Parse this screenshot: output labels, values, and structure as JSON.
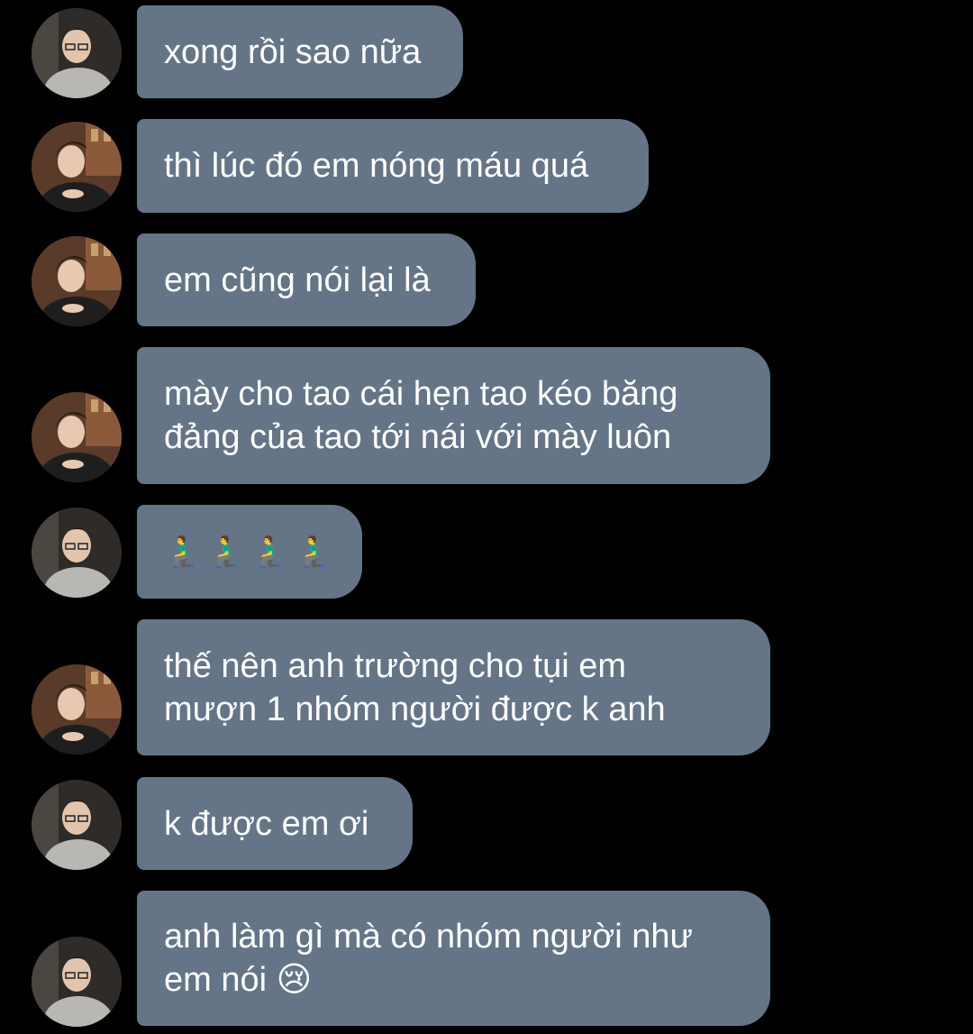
{
  "palette": {
    "background": "#000000",
    "bubble": "#657587",
    "text": "#ffffff"
  },
  "messages": [
    {
      "sender": "user-a",
      "avatar": "avatar-glasses-icon",
      "lines": [
        "xong rồi sao nữa"
      ]
    },
    {
      "sender": "user-b",
      "avatar": "avatar-suit-icon",
      "lines": [
        "thì lúc đó em nóng máu quá"
      ]
    },
    {
      "sender": "user-b",
      "avatar": "avatar-suit-icon",
      "lines": [
        "em cũng nói lại là"
      ]
    },
    {
      "sender": "user-b",
      "avatar": "avatar-suit-icon",
      "lines": [
        "mày cho tao cái hẹn tao kéo băng",
        "đảng của tao tới nái với mày luôn"
      ]
    },
    {
      "sender": "user-a",
      "avatar": "avatar-glasses-icon",
      "lines": [
        "🧎‍♂️🧎‍♂️🧎‍♂️🧎‍♂️"
      ]
    },
    {
      "sender": "user-b",
      "avatar": "avatar-suit-icon",
      "lines": [
        "thế nên anh trường cho tụi em",
        "mượn 1 nhóm người được k anh"
      ]
    },
    {
      "sender": "user-a",
      "avatar": "avatar-glasses-icon",
      "lines": [
        "k được em ơi"
      ]
    },
    {
      "sender": "user-a",
      "avatar": "avatar-glasses-icon",
      "lines": [
        "anh làm gì mà có nhóm người như",
        "em nói 😢"
      ]
    }
  ]
}
